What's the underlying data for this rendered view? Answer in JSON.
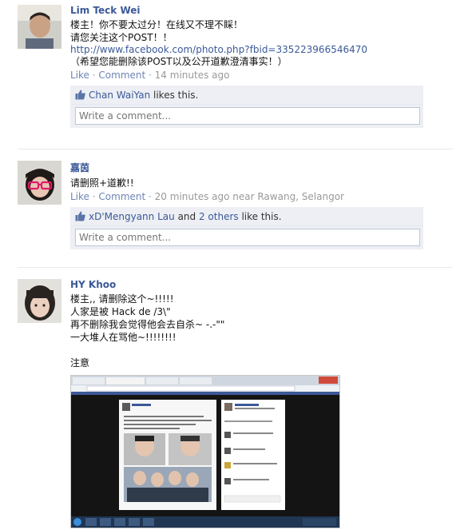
{
  "posts": [
    {
      "author": "Lim Teck Wei",
      "lines": [
        "楼主！你不要太过分！在线又不理不睬！",
        "请您关注这个POST！！"
      ],
      "link": "http://www.facebook.com/photo.php?fbid=335223966546470",
      "lines_after": [
        "（希望您能删除该POST以及公开道歉澄清事实！）"
      ],
      "actions": [
        "Like",
        "Comment"
      ],
      "time": "14 minutes ago",
      "likes": {
        "names": [
          "Chan WaiYan"
        ],
        "suffix": "likes this."
      },
      "comment_placeholder": "Write a comment..."
    },
    {
      "author": "嘉茵",
      "lines": [
        "请删照+道歉!!"
      ],
      "actions": [
        "Like",
        "Comment"
      ],
      "time": "20 minutes ago near Rawang, Selangor",
      "likes": {
        "names": [
          "xD'Mengyann Lau"
        ],
        "joiner": "and",
        "others": "2 others",
        "suffix": "like this."
      },
      "comment_placeholder": "Write a comment..."
    },
    {
      "author": "HY Khoo",
      "lines": [
        "楼主,, 请删除这个~!!!!!",
        "人家是被 Hack de /3\\\"",
        "再不删除我会觉得他会去自杀~ -.-\"\"",
        "一大堆人在骂他~!!!!!!!!",
        "",
        "注意"
      ]
    }
  ],
  "colors": {
    "link": "#3b5998",
    "meta": "#6d84b4",
    "box": "#edeff4"
  }
}
